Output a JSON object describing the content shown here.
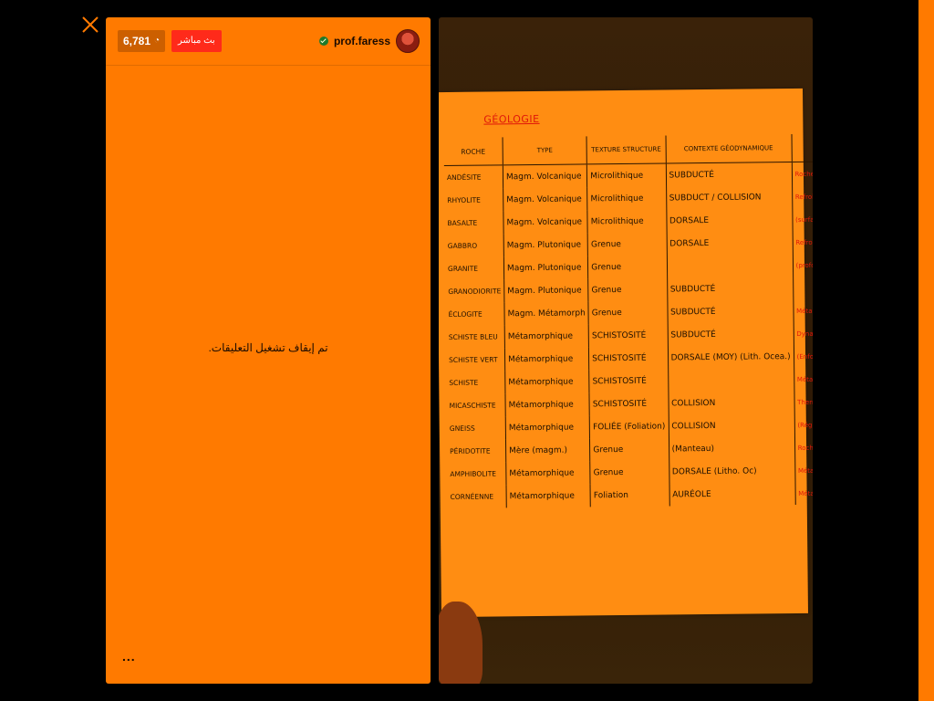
{
  "header": {
    "viewer_count": "6,781",
    "live_label": "بث مباشر",
    "username": "prof.faress"
  },
  "comments": {
    "status_message": "تم إيقاف تشغيل التعليقات.",
    "more_label": "..."
  },
  "video": {
    "notes": {
      "title": "GÉOLOGIE",
      "columns": [
        "ROCHE",
        "TYPE",
        "TEXTURE STRUCTURE",
        "CONTEXTE GÉODYNAMIQUE",
        ""
      ],
      "rows": [
        [
          "ANDÉSITE",
          "Magm. Volcanique",
          "Microlithique",
          "SUBDUCTÉ",
          "Roche Magmatique"
        ],
        [
          "RHYOLITE",
          "Magm. Volcanique",
          "Microlithique",
          "SUBDUCT / COLLISION",
          "Refroidissement rapide"
        ],
        [
          "BASALTE",
          "Magm. Volcanique",
          "Microlithique",
          "DORSALE",
          "(surface)"
        ],
        [
          "GABBRO",
          "Magm. Plutonique",
          "Grenue",
          "DORSALE",
          "Refroidissement lent en"
        ],
        [
          "GRANITE",
          "Magm. Plutonique",
          "Grenue",
          "",
          "(profondeur)"
        ],
        [
          "GRANODIORITE",
          "Magm. Plutonique",
          "Grenue",
          "SUBDUCTÉ",
          ""
        ],
        [
          "ÉCLOGITE",
          "Magm. Métamorph",
          "Grenue",
          "SUBDUCTÉ",
          "Métamorphique"
        ],
        [
          "SCHISTE BLEU",
          "Métamorphique",
          "SCHISTOSITÉ",
          "SUBDUCTÉ",
          "Dynamique"
        ],
        [
          "SCHISTE VERT",
          "Métamorphique",
          "SCHISTOSITÉ",
          "DORSALE (MOY) (Lith. Ocea.)",
          "(Enfouissement)"
        ],
        [
          "SCHISTE",
          "Métamorphique",
          "SCHISTOSITÉ",
          "",
          "Métamorphique"
        ],
        [
          "MICASCHISTE",
          "Métamorphique",
          "SCHISTOSITÉ",
          "COLLISION",
          "Thermodynamique"
        ],
        [
          "GNEISS",
          "Métamorphique",
          "FOLIÉE (Foliation)",
          "COLLISION",
          "(Régional)"
        ],
        [
          "PÉRIDOTITE",
          "Mère (magm.)",
          "Grenue",
          "(Manteau)",
          "Roche Mantellique"
        ],
        [
          "AMPHIBOLITE",
          "Métamorphique",
          "Grenue",
          "DORSALE (Litho. Oc)",
          "Métamorphisme de Dorsale (Hydrothermal)"
        ],
        [
          "CORNÉENNE",
          "Métamorphique",
          "Foliation",
          "AURÉOLE",
          "Métam. de Contact"
        ]
      ]
    }
  },
  "colors": {
    "panel": "#ff7a00",
    "live_badge": "#ff2a1a",
    "background": "#000000"
  }
}
